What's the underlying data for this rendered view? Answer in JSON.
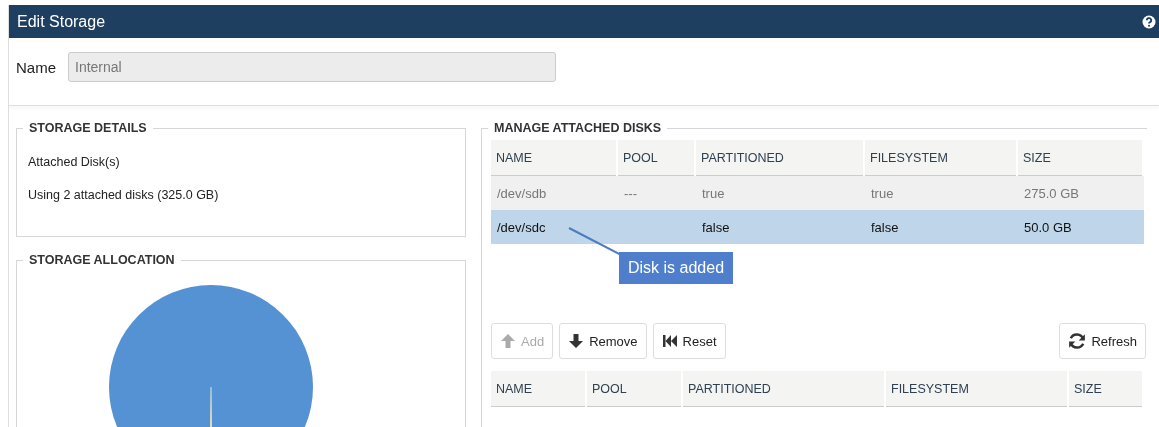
{
  "window": {
    "title": "Edit Storage"
  },
  "name_field": {
    "label": "Name",
    "value": "Internal",
    "disabled": true
  },
  "storage_details": {
    "title": "STORAGE DETAILS",
    "lines": [
      "Attached Disk(s)",
      "Using 2 attached disks (325.0 GB)"
    ]
  },
  "storage_allocation": {
    "title": "STORAGE ALLOCATION"
  },
  "manage_disks": {
    "title": "MANAGE ATTACHED DISKS",
    "attached_table": {
      "columns": [
        "NAME",
        "POOL",
        "PARTITIONED",
        "FILESYSTEM",
        "SIZE"
      ],
      "rows": [
        {
          "cells": [
            "/dev/sdb",
            "---",
            "true",
            "true",
            "275.0 GB"
          ],
          "disabled": true,
          "selected": false
        },
        {
          "cells": [
            "/dev/sdc",
            "",
            "false",
            "false",
            "50.0 GB"
          ],
          "disabled": false,
          "selected": true
        }
      ]
    },
    "callout": {
      "text": "Disk is added"
    },
    "buttons": [
      {
        "label": "Add",
        "disabled": true
      },
      {
        "label": "Remove",
        "disabled": false
      },
      {
        "label": "Reset",
        "disabled": false
      }
    ],
    "refresh_button": {
      "label": "Refresh"
    },
    "available_table": {
      "columns": [
        "NAME",
        "POOL",
        "PARTITIONED",
        "FILESYSTEM",
        "SIZE"
      ]
    }
  }
}
